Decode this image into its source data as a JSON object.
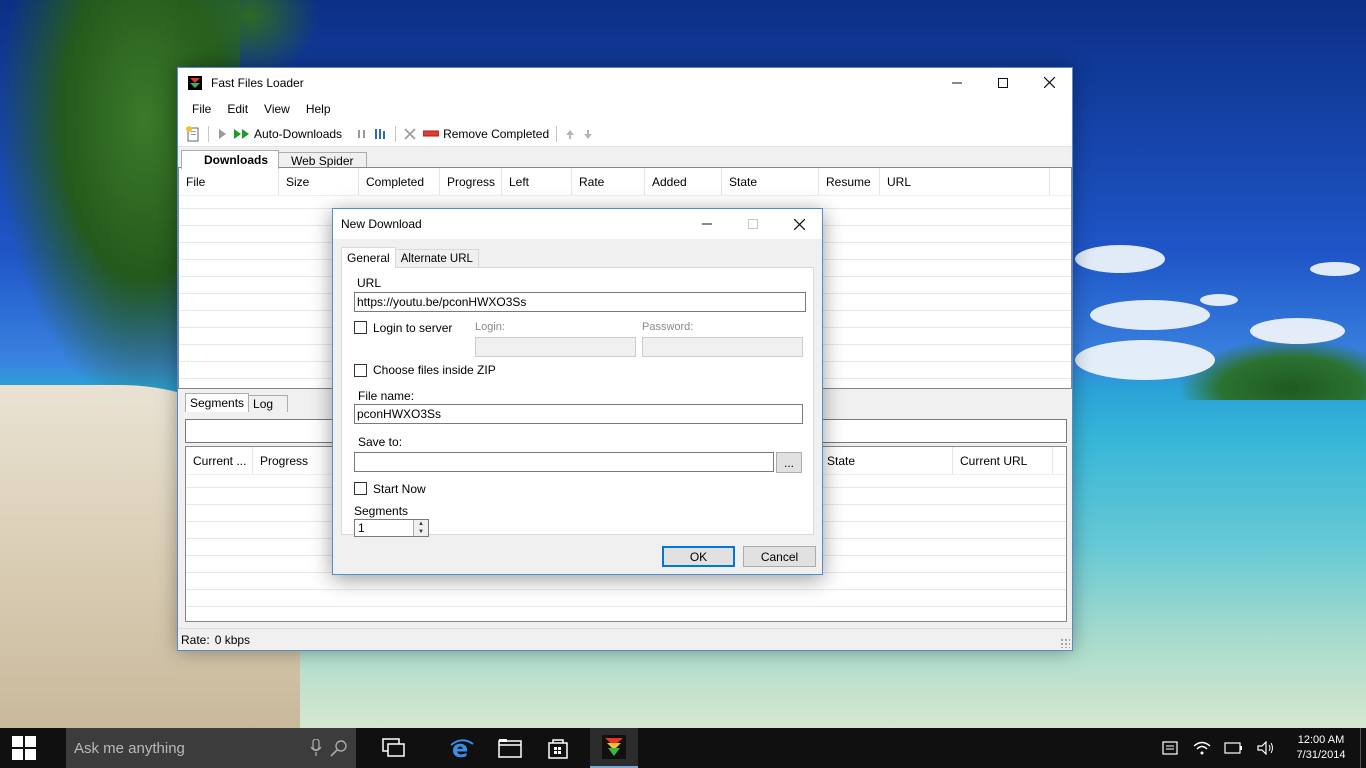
{
  "main_window": {
    "title": "Fast Files Loader",
    "menu": [
      "File",
      "Edit",
      "View",
      "Help"
    ],
    "toolbar": {
      "auto_downloads_label": "Auto-Downloads",
      "remove_completed_label": "Remove Completed"
    },
    "tabs": [
      "Downloads",
      "Web Spider"
    ],
    "downloads_columns": [
      "File",
      "Size",
      "Completed",
      "Progress",
      "Left",
      "Rate",
      "Added",
      "State",
      "Resume",
      "URL"
    ],
    "bottom_tabs": [
      "Segments",
      "Log"
    ],
    "segments_columns": [
      "Current ...",
      "Progress",
      "State",
      "Current URL"
    ],
    "status": {
      "rate_label": "Rate:",
      "rate_value": "0 kbps"
    }
  },
  "dialog": {
    "title": "New Download",
    "tabs": [
      "General",
      "Alternate URL"
    ],
    "url_label": "URL",
    "url_value": "https://youtu.be/pconHWXO3Ss",
    "login_to_server_label": "Login to server",
    "login_label": "Login:",
    "login_value": "",
    "password_label": "Password:",
    "password_value": "",
    "choose_zip_label": "Choose files inside ZIP",
    "file_name_label": "File name:",
    "file_name_value": "pconHWXO3Ss",
    "save_to_label": "Save to:",
    "save_to_value": "",
    "browse_label": "...",
    "start_now_label": "Start Now",
    "segments_label": "Segments",
    "segments_value": "1",
    "ok_label": "OK",
    "cancel_label": "Cancel"
  },
  "taskbar": {
    "search_placeholder": "Ask me anything",
    "time": "12:00 AM",
    "date": "7/31/2014",
    "pinned_icons": [
      "task-view-icon",
      "edge-icon",
      "file-explorer-icon",
      "store-icon",
      "fast-files-loader-icon"
    ],
    "tray_icons": [
      "action-center-icon",
      "wifi-icon",
      "battery-icon",
      "volume-icon"
    ]
  },
  "colors": {
    "accent": "#0078d7",
    "window_border": "#5a8ac6",
    "taskbar": "#101010"
  }
}
